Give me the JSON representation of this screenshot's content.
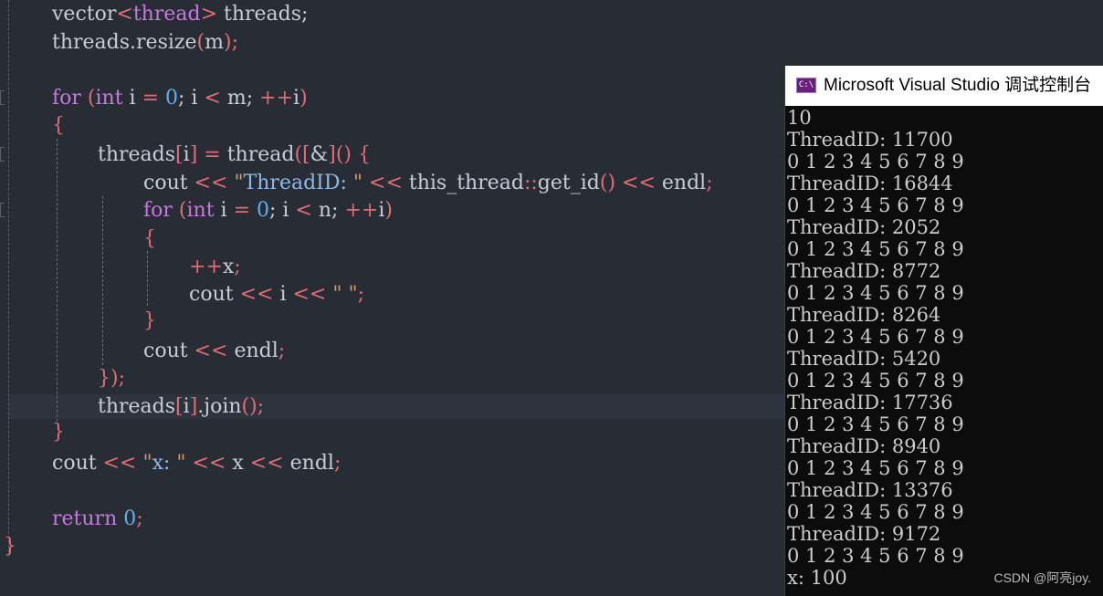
{
  "editor": {
    "code": {
      "l1": {
        "a": "vector",
        "b": "<",
        "c": "thread",
        "d": ">",
        "e": " threads;"
      },
      "l2": {
        "a": "threads.resize",
        "b": "(",
        "c": "m",
        "d": ")",
        "e": ";"
      },
      "l3": {
        "kw": "for",
        "p1": " (",
        "ty": "int",
        "v": " i ",
        "eq": "=",
        "n0": " 0",
        "s1": "; i ",
        "lt": "<",
        "s2": " m; ",
        "inc": "++",
        "s3": "i",
        "p2": ")"
      },
      "l4": {
        "brace": "{"
      },
      "l5": {
        "a": "threads",
        "b": "[",
        "c": "i",
        "d": "]",
        "e": " ",
        "f": "=",
        "g": " thread",
        "h": "([",
        "i": "&",
        "j": "]() {"
      },
      "l6": {
        "a": "cout ",
        "b": "<<",
        "c": " \"",
        "d": "ThreadID: ",
        "e": "\"",
        "f": " ",
        "g": "<<",
        "h": " this_thread",
        "i": "::",
        "j": "get_id",
        "k": "()",
        "l": " ",
        "m": "<<",
        "n": " endl",
        "o": ";"
      },
      "l7": {
        "kw": "for",
        "p1": " (",
        "ty": "int",
        "v": " i ",
        "eq": "=",
        "n0": " 0",
        "s1": "; i ",
        "lt": "<",
        "s2": " n; ",
        "inc": "++",
        "s3": "i",
        "p2": ")"
      },
      "l8": {
        "brace": "{"
      },
      "l9": {
        "inc": "++",
        "v": "x",
        "s": ";"
      },
      "l10": {
        "a": "cout ",
        "b": "<<",
        "c": " i ",
        "d": "<<",
        "e": " \" \"",
        "f": ";"
      },
      "l11": {
        "brace": "}"
      },
      "l12": {
        "a": "cout ",
        "b": "<<",
        "c": " endl",
        "d": ";"
      },
      "l13": {
        "a": "});"
      },
      "l14": {
        "a": "threads",
        "b": "[",
        "c": "i",
        "d": "]",
        "e": ".join",
        "f": "()",
        "g": ";"
      },
      "l15": {
        "brace": "}"
      },
      "l16": {
        "a": "cout ",
        "b": "<<",
        "c": " \"",
        "d": "x: ",
        "e": "\"",
        "f": " ",
        "g": "<<",
        "h": " x ",
        "i": "<<",
        "j": " endl",
        "k": ";"
      },
      "l17": {
        "kw": "return",
        "n0": " 0",
        "s": ";"
      },
      "l18": {
        "brace": "}"
      }
    }
  },
  "console": {
    "title": "Microsoft Visual Studio 调试控制台",
    "icon_glyph": "C:\\",
    "icon": "console-app-icon",
    "output": [
      "10",
      "ThreadID: 11700",
      "0 1 2 3 4 5 6 7 8 9",
      "ThreadID: 16844",
      "0 1 2 3 4 5 6 7 8 9",
      "ThreadID: 2052",
      "0 1 2 3 4 5 6 7 8 9",
      "ThreadID: 8772",
      "0 1 2 3 4 5 6 7 8 9",
      "ThreadID: 8264",
      "0 1 2 3 4 5 6 7 8 9",
      "ThreadID: 5420",
      "0 1 2 3 4 5 6 7 8 9",
      "ThreadID: 17736",
      "0 1 2 3 4 5 6 7 8 9",
      "ThreadID: 8940",
      "0 1 2 3 4 5 6 7 8 9",
      "ThreadID: 13376",
      "0 1 2 3 4 5 6 7 8 9",
      "ThreadID: 9172",
      "0 1 2 3 4 5 6 7 8 9",
      "x: 100"
    ]
  },
  "watermark": "CSDN @阿亮joy.",
  "colors": {
    "editor_bg": "#282c34",
    "keyword": "#c678dd",
    "number": "#61afef",
    "operator": "#e06c75",
    "string": "#d19a66",
    "console_bg": "#0c0c0c",
    "console_text": "#cccccc"
  }
}
